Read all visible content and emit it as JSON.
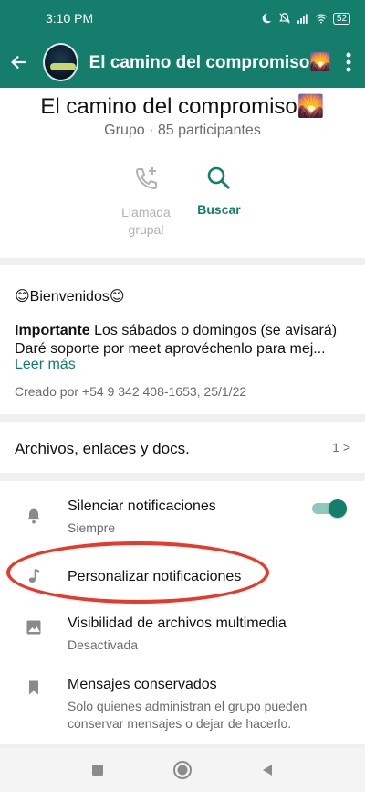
{
  "status_bar": {
    "time": "3:10 PM",
    "battery": "52"
  },
  "app_bar": {
    "title": "El camino del compromiso🌄"
  },
  "header": {
    "group_name": "El camino del compromiso🌄",
    "subtitle": "Grupo · 85 participantes",
    "actions": [
      {
        "label": "Llamada grupal",
        "icon": "add-call-icon",
        "enabled": false
      },
      {
        "label": "Buscar",
        "icon": "search-icon",
        "enabled": true
      }
    ]
  },
  "description": {
    "title": "😊Bienvenidos😊",
    "bold_lead": "Importante",
    "body": " Los sábados o domingos (se avisará) Daré soporte por meet aprovéchenlo para mej...",
    "read_more": "Leer más",
    "created": "Creado por +54 9 342 408-1653, 25/1/22"
  },
  "files": {
    "label": "Archivos, enlaces y docs.",
    "count": "1 >"
  },
  "settings": [
    {
      "title": "Silenciar notificaciones",
      "subtitle": "Siempre",
      "icon": "bell-icon",
      "toggle_on": true
    },
    {
      "title": "Personalizar notificaciones",
      "subtitle": "",
      "icon": "music-note-icon"
    },
    {
      "title": "Visibilidad de archivos multimedia",
      "subtitle": "Desactivada",
      "icon": "image-icon"
    },
    {
      "title": "Mensajes conservados",
      "subtitle": "Solo quienes administran el grupo pueden conservar mensajes o dejar de hacerlo.",
      "icon": "bookmark-icon"
    }
  ],
  "colors": {
    "accent": "#147d6b",
    "highlight_ring": "#e53a2c"
  }
}
